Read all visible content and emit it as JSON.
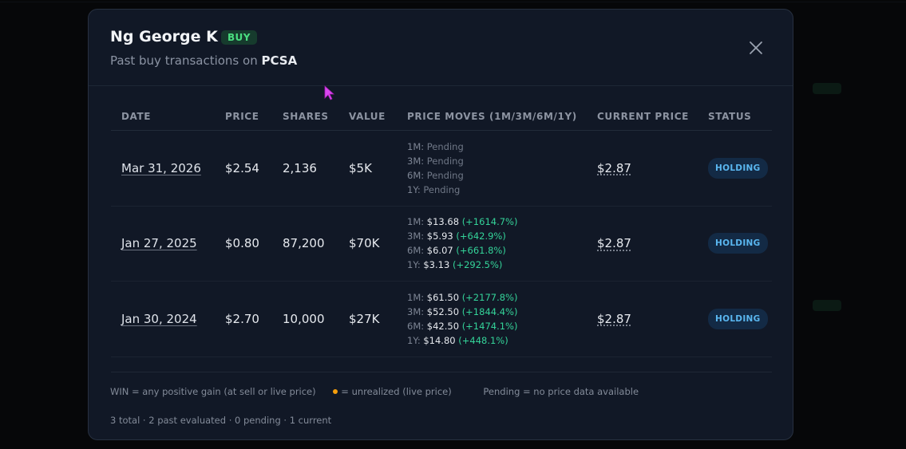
{
  "modal": {
    "title": "Ng George K",
    "badge": "BUY",
    "subtitle_prefix": "Past buy transactions on ",
    "ticker": "PCSA"
  },
  "table": {
    "headers": [
      "DATE",
      "PRICE",
      "SHARES",
      "VALUE",
      "PRICE MOVES (1M/3M/6M/1Y)",
      "CURRENT PRICE",
      "STATUS"
    ],
    "rows": [
      {
        "date": "Mar 31, 2026",
        "price": "$2.54",
        "shares": "2,136",
        "value": "$5K",
        "moves": [
          {
            "label": "1M:",
            "value": "Pending",
            "pct": ""
          },
          {
            "label": "3M:",
            "value": "Pending",
            "pct": ""
          },
          {
            "label": "6M:",
            "value": "Pending",
            "pct": ""
          },
          {
            "label": "1Y:",
            "value": "Pending",
            "pct": ""
          }
        ],
        "current_price": "$2.87",
        "status": "HOLDING"
      },
      {
        "date": "Jan 27, 2025",
        "price": "$0.80",
        "shares": "87,200",
        "value": "$70K",
        "moves": [
          {
            "label": "1M:",
            "value": "$13.68",
            "pct": "(+1614.7%)"
          },
          {
            "label": "3M:",
            "value": "$5.93",
            "pct": "(+642.9%)"
          },
          {
            "label": "6M:",
            "value": "$6.07",
            "pct": "(+661.8%)"
          },
          {
            "label": "1Y:",
            "value": "$3.13",
            "pct": "(+292.5%)"
          }
        ],
        "current_price": "$2.87",
        "status": "HOLDING"
      },
      {
        "date": "Jan 30, 2024",
        "price": "$2.70",
        "shares": "10,000",
        "value": "$27K",
        "moves": [
          {
            "label": "1M:",
            "value": "$61.50",
            "pct": "(+2177.8%)"
          },
          {
            "label": "3M:",
            "value": "$52.50",
            "pct": "(+1844.4%)"
          },
          {
            "label": "6M:",
            "value": "$42.50",
            "pct": "(+1474.1%)"
          },
          {
            "label": "1Y:",
            "value": "$14.80",
            "pct": "(+448.1%)"
          }
        ],
        "current_price": "$2.87",
        "status": "HOLDING"
      }
    ]
  },
  "legend": {
    "win": "WIN = any positive gain (at sell or live price)",
    "unrealized": "= unrealized (live price)",
    "pending": "Pending = no price data available"
  },
  "summary": "3 total · 2 past evaluated · 0 pending · 1 current",
  "colors": {
    "modal_bg": "#111826",
    "buy_badge": "#4ade80",
    "gain": "#34d399",
    "holding": "#5ab7f0",
    "unrealized_dot": "#f59e0b"
  }
}
